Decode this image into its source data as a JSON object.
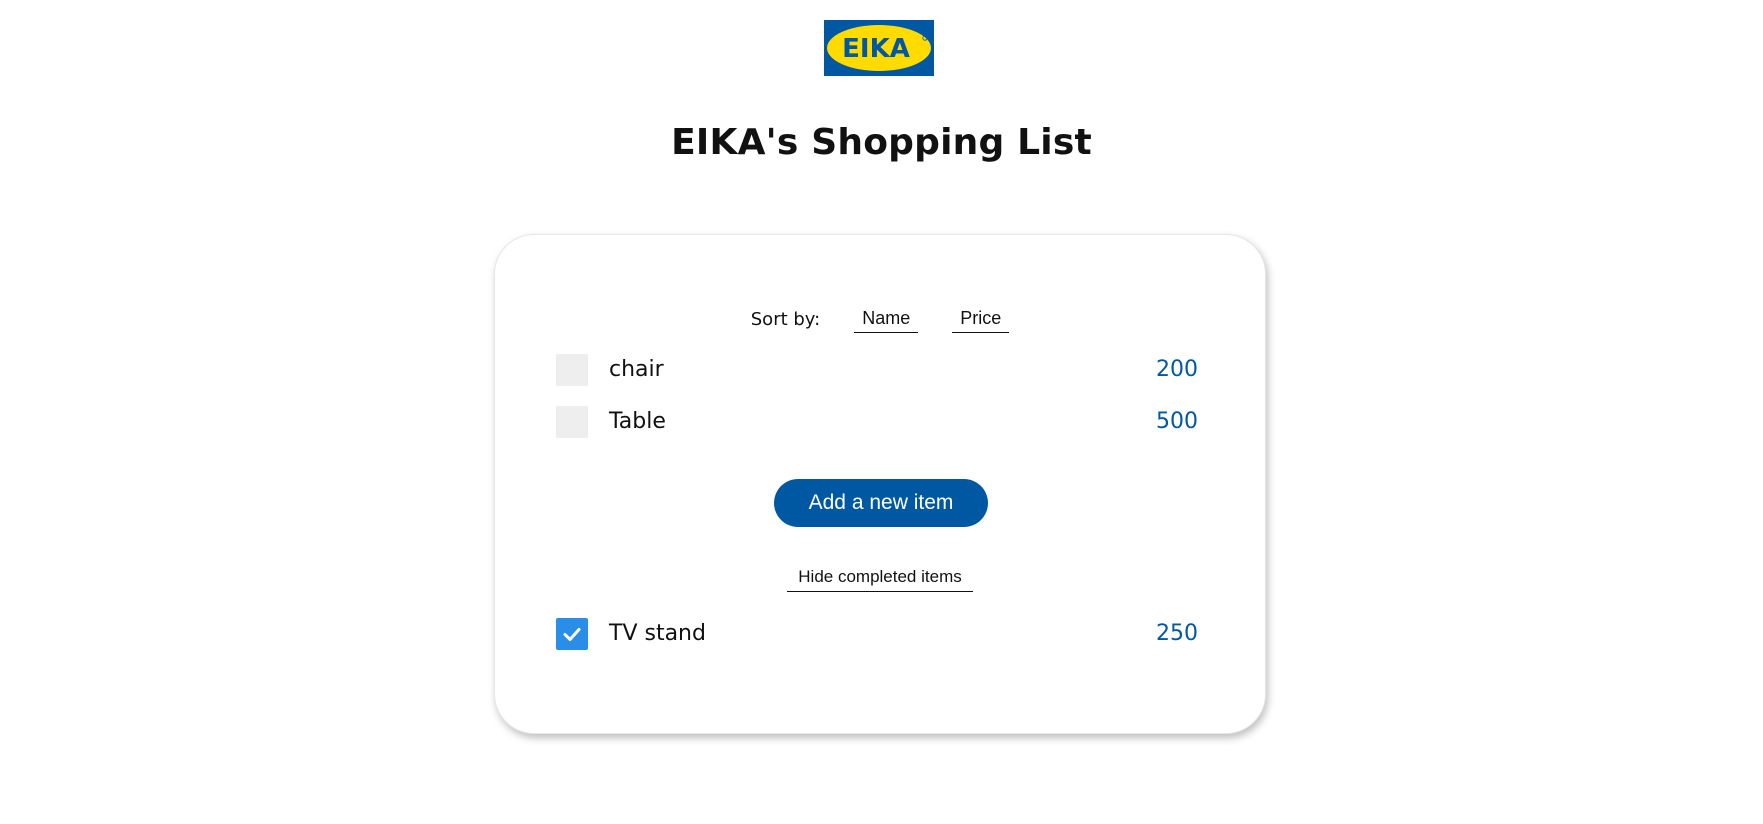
{
  "logo": {
    "text": "EIKA",
    "colors": {
      "background": "#0058a3",
      "ellipse": "#ffdb00",
      "text": "#0058a3"
    }
  },
  "header": {
    "title": "EIKA's Shopping List"
  },
  "sort": {
    "label": "Sort by:",
    "name_label": "Name",
    "price_label": "Price"
  },
  "items": [
    {
      "name": "chair",
      "price": "200",
      "completed": false
    },
    {
      "name": "Table",
      "price": "500",
      "completed": false
    }
  ],
  "add_button_label": "Add a new item",
  "hide_completed_label": "Hide completed items",
  "completed_items": [
    {
      "name": "TV stand",
      "price": "250",
      "completed": true
    }
  ],
  "colors": {
    "accent": "#0058a3",
    "checkbox_checked": "#2a8ee8",
    "checkbox_unchecked": "#eeeeee"
  }
}
